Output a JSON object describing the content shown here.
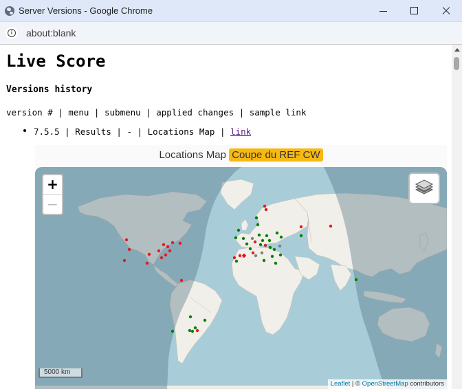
{
  "window": {
    "title": "Server Versions - Google Chrome",
    "url": "about:blank"
  },
  "page": {
    "title": "Live Score",
    "subheading": "Versions history",
    "legend": "version # | menu | submenu | applied changes | sample link",
    "entries": [
      {
        "version": "7.5.5",
        "menu": "Results",
        "submenu": "-",
        "changes": "Locations Map",
        "link_text": "link",
        "separator": " | "
      }
    ]
  },
  "map": {
    "heading": "Locations Map",
    "badge": "Coupe du REF CW",
    "zoom_in": "+",
    "zoom_out": "−",
    "scale": "5000 km",
    "attribution_leaflet": "Leaflet",
    "attribution_sep": " | © ",
    "attribution_osm": "OpenStreetMap",
    "attribution_tail": " contributors",
    "colors": {
      "ocean": "#a8cdd8",
      "land": "#f1efe9",
      "night": "#4f6f80",
      "marker_red": "#e31a1c",
      "marker_green": "#008000",
      "marker_gray": "#808080",
      "badge": "#f6b912"
    }
  }
}
